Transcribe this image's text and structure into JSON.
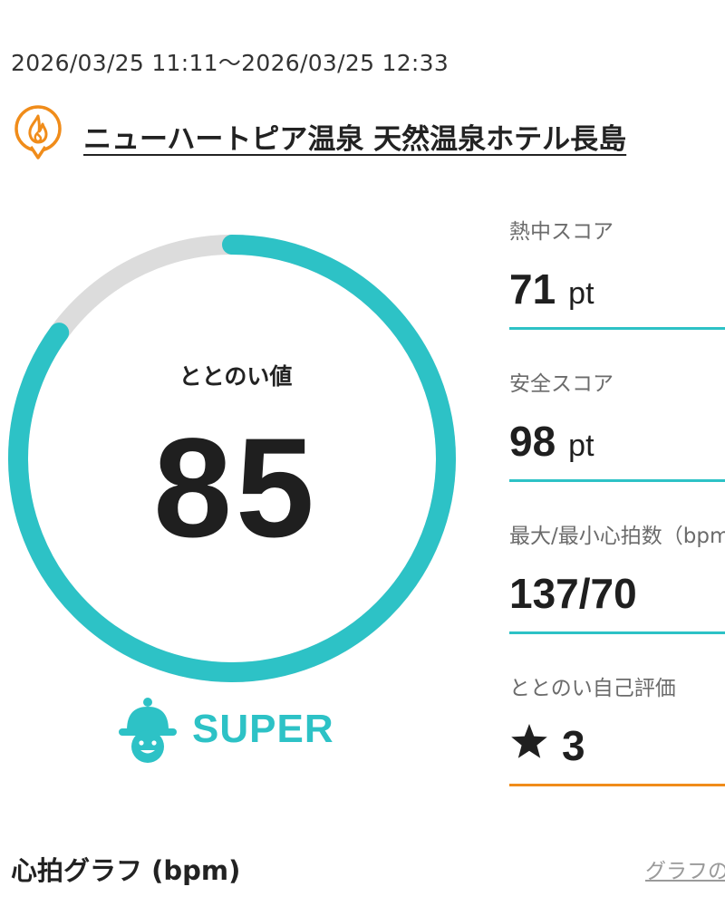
{
  "session": {
    "time_range": "2026/03/25 11:11～2026/03/25 12:33"
  },
  "facility": {
    "icon": "sauna-flame-icon",
    "name": "ニューハートピア温泉 天然温泉ホテル長島",
    "icon_color": "#f08c1a"
  },
  "totonoi": {
    "label": "ととのい値",
    "value": "85",
    "progress_percent": 85,
    "rank": "SUPER",
    "rank_icon": "hat-face-icon",
    "accent_color": "#2dc2c6",
    "track_color": "#dcdcdc"
  },
  "metrics": [
    {
      "label": "熱中スコア",
      "value": "71",
      "unit": "pt"
    },
    {
      "label": "安全スコア",
      "value": "98",
      "unit": "pt"
    },
    {
      "label": "最大/最小心拍数（bpm）",
      "value": "137/70",
      "unit": ""
    },
    {
      "label": "ととのい自己評価",
      "value": "3",
      "unit": "",
      "icon": "star-icon"
    }
  ],
  "graph": {
    "title": "心拍グラフ (bpm)",
    "link": "グラフの"
  }
}
